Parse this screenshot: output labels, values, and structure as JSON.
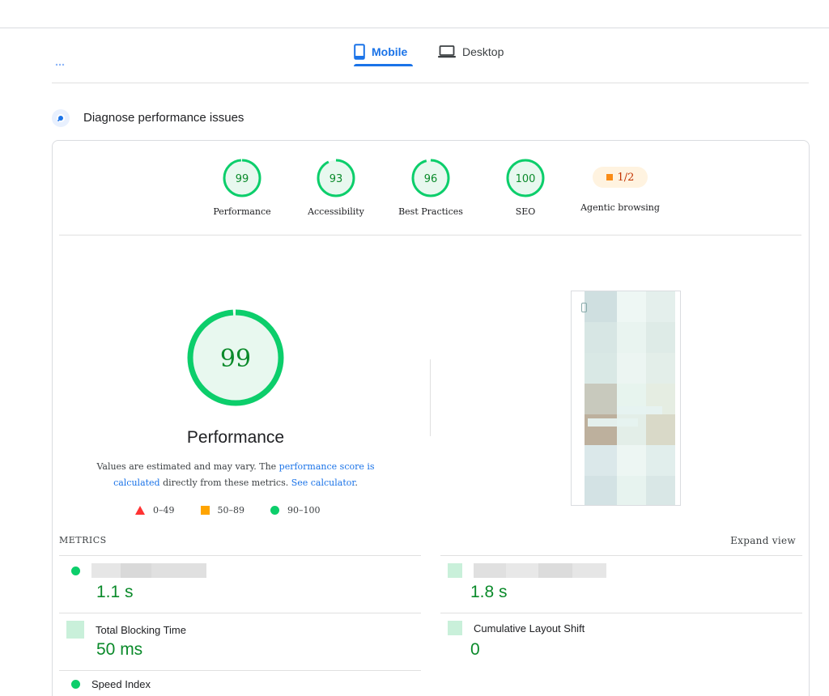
{
  "tabs": {
    "mobile_label": "Mobile",
    "desktop_label": "Desktop"
  },
  "section": {
    "title": "Diagnose performance issues"
  },
  "categories": [
    {
      "label": "Performance",
      "score": "99",
      "fraction": 0.99
    },
    {
      "label": "Accessibility",
      "score": "93",
      "fraction": 0.93
    },
    {
      "label": "Best Practices",
      "score": "96",
      "fraction": 0.96
    },
    {
      "label": "SEO",
      "score": "100",
      "fraction": 1.0
    },
    {
      "label": "Agentic browsing",
      "score": "1/2"
    }
  ],
  "performance": {
    "score": "99",
    "fraction": 0.99,
    "title": "Performance",
    "desc_1": "Values are estimated and may vary. The ",
    "link_1": "performance score is calculated",
    "desc_2": " directly from these metrics. ",
    "link_2": "See calculator",
    "desc_3": "."
  },
  "legend": {
    "fail": "0–49",
    "average": "50–89",
    "pass": "90–100"
  },
  "metrics": {
    "header": "METRICS",
    "expand_label": "Expand view",
    "items": [
      {
        "name": "",
        "value": "1.1 s"
      },
      {
        "name": "",
        "value": "1.8 s"
      },
      {
        "name": "Total Blocking Time",
        "value": "50 ms"
      },
      {
        "name": "Cumulative Layout Shift",
        "value": "0"
      },
      {
        "name": "Speed Index",
        "value": ""
      }
    ]
  },
  "colors": {
    "accent": "#1a73e8",
    "pass": "#0cce6b",
    "pass_text": "#0a8a2a",
    "pass_bg": "#e8f8ef",
    "average": "#ffa400",
    "fail": "#ff3333"
  }
}
